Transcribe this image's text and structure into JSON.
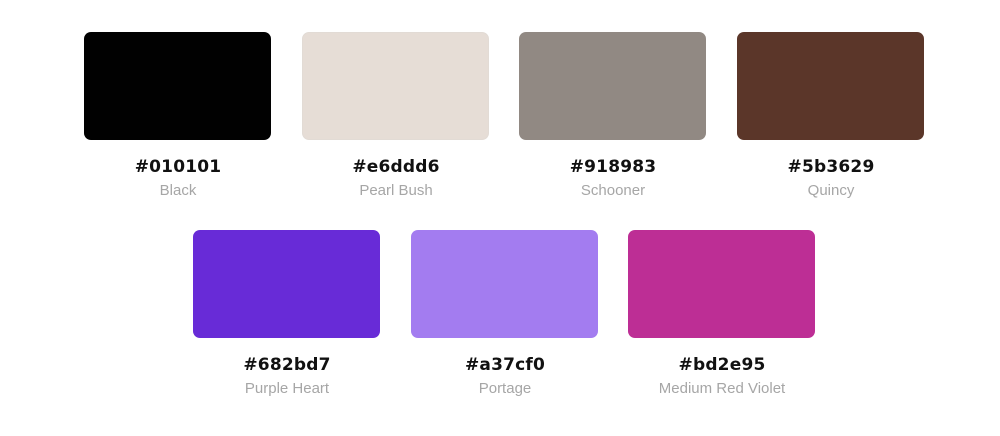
{
  "swatches": [
    {
      "hex": "#010101",
      "name": "Black",
      "color": "#010101"
    },
    {
      "hex": "#e6ddd6",
      "name": "Pearl Bush",
      "color": "#e6ddd6"
    },
    {
      "hex": "#918983",
      "name": "Schooner",
      "color": "#918983"
    },
    {
      "hex": "#5b3629",
      "name": "Quincy",
      "color": "#5b3629"
    },
    {
      "hex": "#682bd7",
      "name": "Purple Heart",
      "color": "#682bd7"
    },
    {
      "hex": "#a37cf0",
      "name": "Portage",
      "color": "#a37cf0"
    },
    {
      "hex": "#bd2e95",
      "name": "Medium Red Violet",
      "color": "#bd2e95"
    }
  ]
}
